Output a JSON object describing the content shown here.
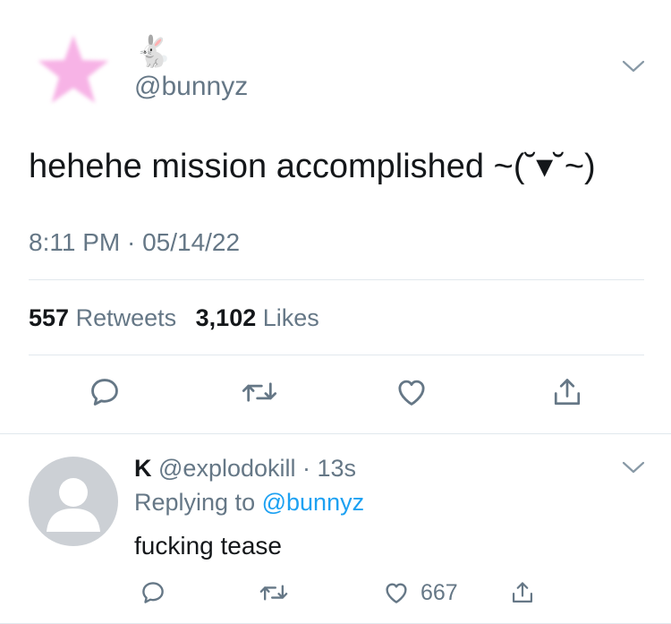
{
  "tweet": {
    "name_emoji": "🐇",
    "handle": "@bunnyz",
    "text": "hehehe mission accomplished ~(˘▾˘~)",
    "timestamp": "8:11 PM · 05/14/22",
    "retweets_count": "557",
    "retweets_label": "Retweets",
    "likes_count": "3,102",
    "likes_label": "Likes",
    "actions": [
      "reply-icon",
      "retweet-icon",
      "like-icon",
      "share-icon"
    ]
  },
  "reply": {
    "name": "K",
    "handle": "@explodokill",
    "time": "· 13s",
    "replying_prefix": "Replying to",
    "replying_mention": "@bunnyz",
    "text": "fucking tease",
    "like_count": "667",
    "actions": [
      "reply-icon",
      "retweet-icon",
      "like-icon",
      "share-icon"
    ]
  },
  "colors": {
    "primary_text": "#14171a",
    "secondary_text": "#657786",
    "link": "#1da1f2",
    "icon": "#657786",
    "divider": "#e1e8ed",
    "avatar_star": "#f7b3e6",
    "default_avatar": "#ccd0d5"
  }
}
